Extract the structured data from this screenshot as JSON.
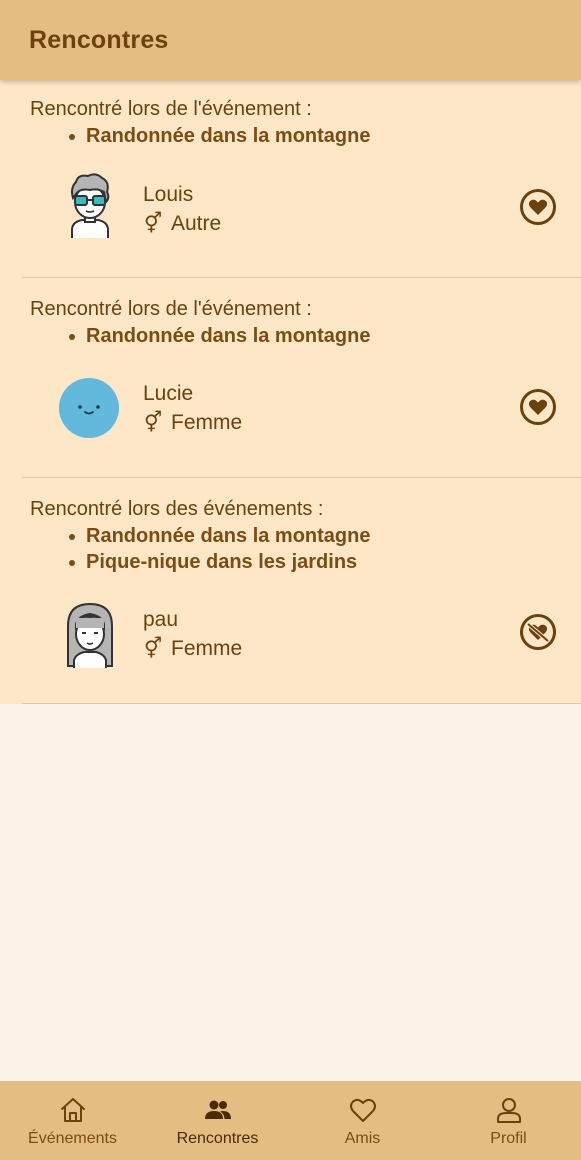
{
  "header": {
    "title": "Rencontres"
  },
  "matches": [
    {
      "event_heading": "Rencontré lors de l'événement :",
      "events": [
        "Randonnée dans la montagne"
      ],
      "name": "Louis",
      "gender_icon": "gender-symbol-icon",
      "gender": "Autre",
      "like_icon": "heart-filled-icon"
    },
    {
      "event_heading": "Rencontré lors de l'événement :",
      "events": [
        "Randonnée dans la montagne"
      ],
      "name": "Lucie",
      "gender_icon": "gender-symbol-icon",
      "gender": "Femme",
      "like_icon": "heart-filled-icon"
    },
    {
      "event_heading": "Rencontré lors des événements :",
      "events": [
        "Randonnée dans la montagne",
        "Pique-nique dans les jardins"
      ],
      "name": "pau",
      "gender_icon": "gender-symbol-icon",
      "gender": "Femme",
      "like_icon": "heart-crossed-icon"
    }
  ],
  "nav": {
    "items": [
      {
        "label": "Événements",
        "icon": "home-icon",
        "active": false
      },
      {
        "label": "Rencontres",
        "icon": "people-icon",
        "active": true
      },
      {
        "label": "Amis",
        "icon": "heart-outline-icon",
        "active": false
      },
      {
        "label": "Profil",
        "icon": "person-icon",
        "active": false
      }
    ]
  },
  "colors": {
    "app_bar": "#e4bd82",
    "card_background": "#fee7c6",
    "page_background": "#fcf3e6",
    "accent_brown": "#6b420d"
  }
}
